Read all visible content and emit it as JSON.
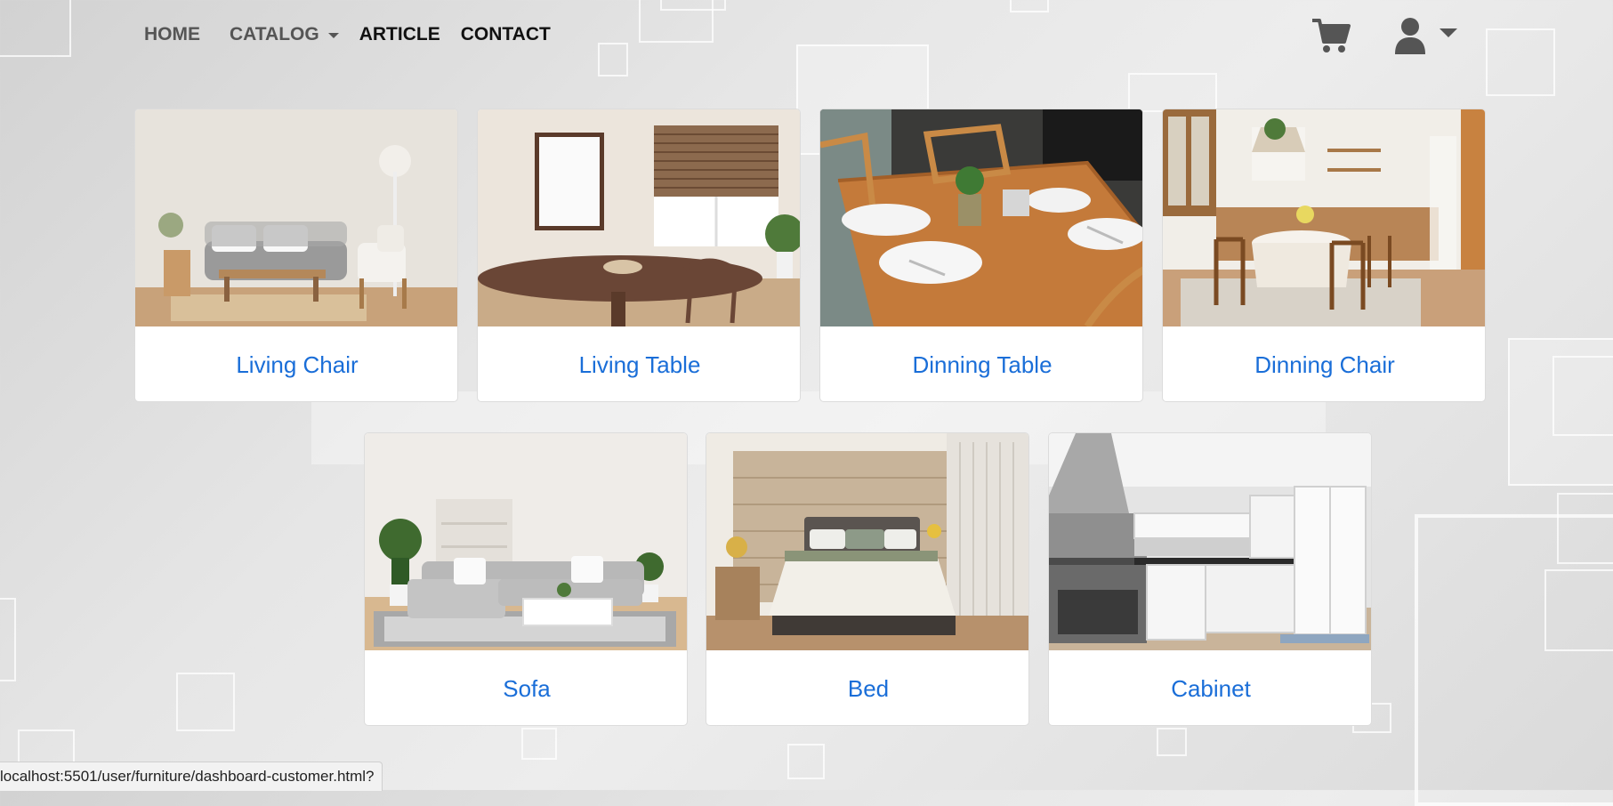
{
  "nav": {
    "home": "HOME",
    "catalog": "CATALOG",
    "article": "ARTICLE",
    "contact": "CONTACT"
  },
  "products": [
    {
      "label": "Living Chair",
      "scene": "living-room-scene"
    },
    {
      "label": "Living Table",
      "scene": "round-table-scene"
    },
    {
      "label": "Dinning Table",
      "scene": "wooden-dining-table-scene"
    },
    {
      "label": "Dinning Chair",
      "scene": "kitchen-dining-scene"
    },
    {
      "label": "Sofa",
      "scene": "sofa-room-scene"
    },
    {
      "label": "Bed",
      "scene": "bedroom-scene"
    },
    {
      "label": "Cabinet",
      "scene": "white-kitchen-scene"
    }
  ],
  "status_url": "localhost:5501/user/furniture/dashboard-customer.html?",
  "colors": {
    "title_link": "#1a6ed8",
    "nav_dim": "#555555",
    "nav_active": "#111111",
    "icon": "#555555"
  }
}
